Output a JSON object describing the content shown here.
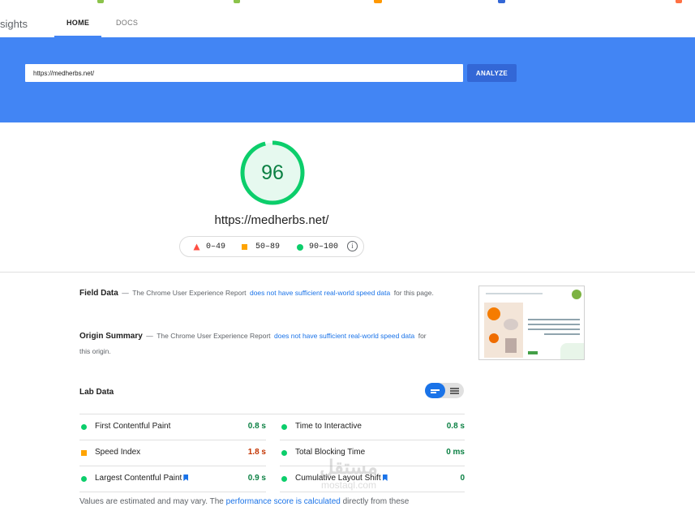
{
  "colors": {
    "accent": "#4285f4",
    "pass": "#0cce6b",
    "average": "#ffa400",
    "fail": "#ff4e42",
    "link": "#1a73e8"
  },
  "nav": {
    "brand": "sights",
    "tabs": [
      {
        "label": "HOME"
      },
      {
        "label": "DOCS"
      }
    ]
  },
  "search": {
    "url_value": "https://medherbs.net/",
    "analyze_label": "ANALYZE"
  },
  "summary": {
    "score": "96",
    "score_fraction": 0.96,
    "url": "https://medherbs.net/",
    "legend": [
      {
        "range": "0–49",
        "icon": "triangle-icon"
      },
      {
        "range": "50–89",
        "icon": "square-icon"
      },
      {
        "range": "90–100",
        "icon": "circle-icon"
      }
    ],
    "info_glyph": "i"
  },
  "field_data": {
    "title": "Field Data",
    "dash": "—",
    "text_a": "The Chrome User Experience Report",
    "link": "does not have sufficient real-world speed data",
    "text_b": "for this page."
  },
  "origin_summary": {
    "title": "Origin Summary",
    "dash": "—",
    "text_a": "The Chrome User Experience Report",
    "link": "does not have sufficient real-world speed data",
    "text_b": "for this origin."
  },
  "lab_data": {
    "title": "Lab Data",
    "metrics": [
      {
        "name": "First Contentful Paint",
        "value": "0.8 s",
        "status": "pass"
      },
      {
        "name": "Time to Interactive",
        "value": "0.8 s",
        "status": "pass"
      },
      {
        "name": "Speed Index",
        "value": "1.8 s",
        "status": "average"
      },
      {
        "name": "Total Blocking Time",
        "value": "0 ms",
        "status": "pass"
      },
      {
        "name": "Largest Contentful Paint",
        "value": "0.9 s",
        "status": "pass"
      },
      {
        "name": "Cumulative Layout Shift",
        "value": "0",
        "status": "pass"
      }
    ],
    "footnote_a": "Values are estimated and may vary. The",
    "footnote_link": "performance score is calculated",
    "footnote_b": "directly from these"
  },
  "watermark": {
    "arabic": "مستقل",
    "latin": "mostaql.com"
  }
}
